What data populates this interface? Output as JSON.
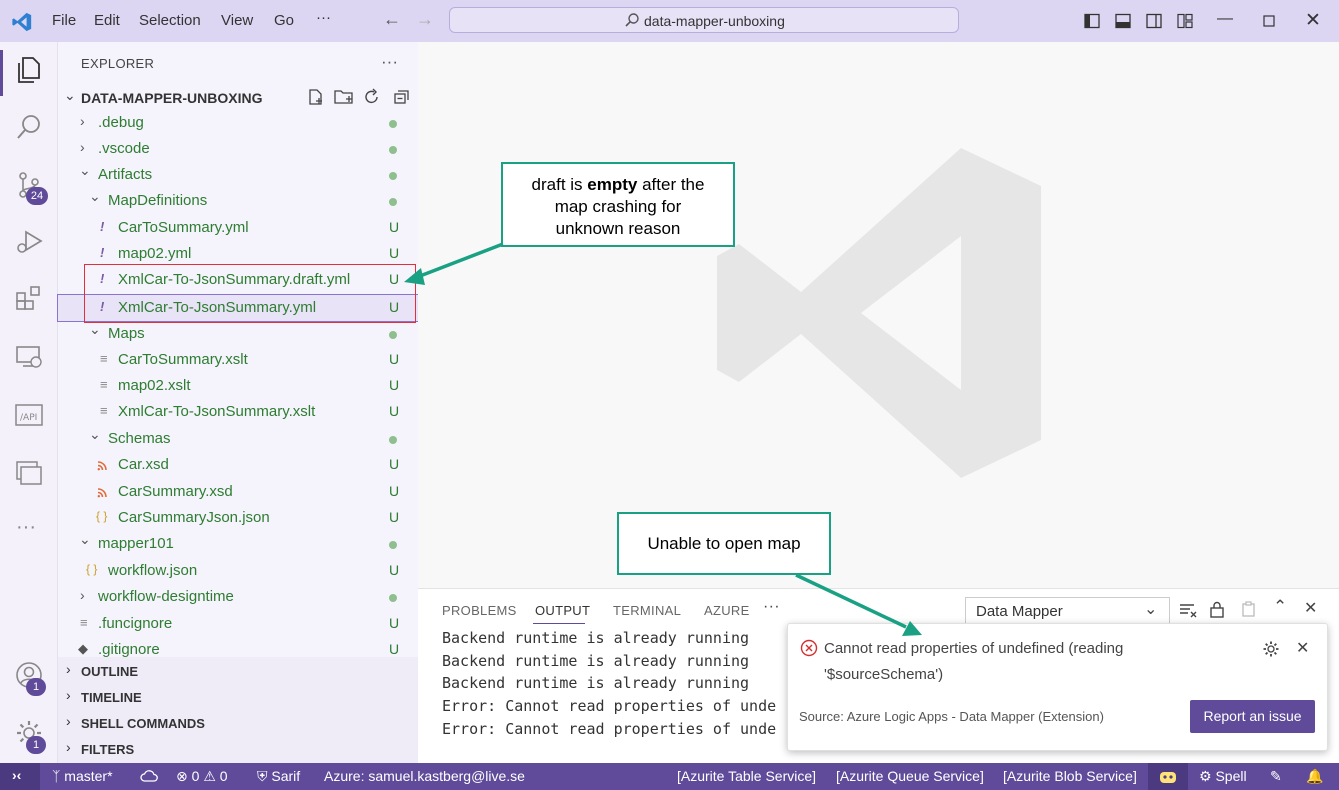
{
  "titlebar": {
    "menus": [
      "File",
      "Edit",
      "Selection",
      "View",
      "Go",
      "···"
    ],
    "search_text": "data-mapper-unboxing"
  },
  "activity": {
    "scm_badge": "24",
    "account_badge": "1",
    "settings_badge": "1"
  },
  "explorer": {
    "title": "EXPLORER",
    "more": "···",
    "root": "DATA-MAPPER-UNBOXING",
    "items": [
      {
        "label": ".debug",
        "status": "dot"
      },
      {
        "label": ".vscode",
        "status": "dot"
      },
      {
        "label": "Artifacts",
        "status": "dot"
      },
      {
        "label": "MapDefinitions",
        "status": "dot"
      },
      {
        "label": "CarToSummary.yml",
        "status": "U"
      },
      {
        "label": "map02.yml",
        "status": "U"
      },
      {
        "label": "XmlCar-To-JsonSummary.draft.yml",
        "status": "U"
      },
      {
        "label": "XmlCar-To-JsonSummary.yml",
        "status": "U"
      },
      {
        "label": "Maps",
        "status": "dot"
      },
      {
        "label": "CarToSummary.xslt",
        "status": "U"
      },
      {
        "label": "map02.xslt",
        "status": "U"
      },
      {
        "label": "XmlCar-To-JsonSummary.xslt",
        "status": "U"
      },
      {
        "label": "Schemas",
        "status": "dot"
      },
      {
        "label": "Car.xsd",
        "status": "U"
      },
      {
        "label": "CarSummary.xsd",
        "status": "U"
      },
      {
        "label": "CarSummaryJson.json",
        "status": "U"
      },
      {
        "label": "mapper101",
        "status": "dot"
      },
      {
        "label": "workflow.json",
        "status": "U"
      },
      {
        "label": "workflow-designtime",
        "status": "dot"
      },
      {
        "label": ".funcignore",
        "status": "U"
      },
      {
        "label": ".gitignore",
        "status": "U"
      }
    ],
    "sections": [
      "OUTLINE",
      "TIMELINE",
      "SHELL COMMANDS",
      "FILTERS"
    ]
  },
  "panel": {
    "tabs": [
      "PROBLEMS",
      "OUTPUT",
      "TERMINAL",
      "AZURE",
      "···"
    ],
    "channel": "Data Mapper",
    "lines": [
      "Backend runtime is already running",
      "Backend runtime is already running",
      "Backend runtime is already running",
      "Error: Cannot read properties of unde",
      "Error: Cannot read properties of unde"
    ]
  },
  "toast": {
    "message_line1": "Cannot read properties of undefined (reading",
    "message_line2": "'$sourceSchema')",
    "source": "Source: Azure Logic Apps - Data Mapper (Extension)",
    "button": "Report an issue"
  },
  "statusbar": {
    "branch": "master*",
    "problems_errors": "0",
    "problems_warnings": "0",
    "sarif": "Sarif",
    "azure_account": "Azure: samuel.kastberg@live.se",
    "azurite_table": "[Azurite Table Service]",
    "azurite_queue": "[Azurite Queue Service]",
    "azurite_blob": "[Azurite Blob Service]",
    "spell": "Spell"
  },
  "annotations": {
    "draft_note_pre": "draft is ",
    "draft_note_bold": "empty",
    "draft_note_post1": " after the",
    "draft_note_line2": "map crashing for",
    "draft_note_line3": "unknown reason",
    "open_note": "Unable to open map"
  },
  "colors": {
    "accent": "#5f4b99",
    "git_untracked": "#2e7d32",
    "callout_border": "#1aa184",
    "error": "#d32f2f"
  }
}
